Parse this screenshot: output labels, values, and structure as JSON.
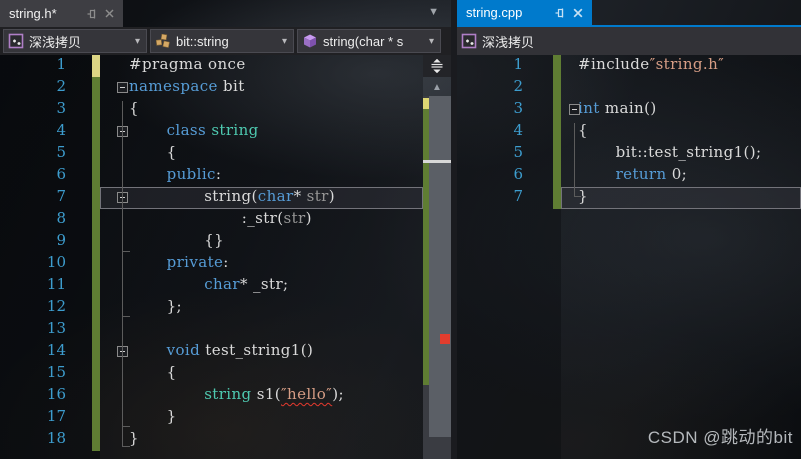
{
  "watermark": "CSDN @跳动的bit",
  "icons": {
    "caret_down": "▾",
    "doc_dropdown": "▼",
    "scroll_up_arrow": "▲"
  },
  "left_pane": {
    "tab": {
      "title": "string.h*"
    },
    "nav": [
      {
        "label": "深浅拷贝",
        "icon": "cpp-project-icon"
      },
      {
        "label": "bit::string",
        "icon": "class-icon"
      },
      {
        "label": "string(char * s",
        "icon": "method-icon"
      }
    ],
    "lines": [
      {
        "n": "1",
        "track": "yellow",
        "ind": 0,
        "segs": [
          [
            "pl",
            "#pragma once"
          ]
        ]
      },
      {
        "n": "2",
        "track": "green",
        "ind": 0,
        "fold": true,
        "segs": [
          [
            "kw",
            "namespace"
          ],
          [
            "pl",
            " bit"
          ]
        ]
      },
      {
        "n": "3",
        "track": "green",
        "ind": 0,
        "segs": [
          [
            "pl",
            "{"
          ]
        ]
      },
      {
        "n": "4",
        "track": "green",
        "ind": 4,
        "fold": true,
        "segs": [
          [
            "kw",
            "class "
          ],
          [
            "ty",
            "string"
          ]
        ]
      },
      {
        "n": "5",
        "track": "green",
        "ind": 4,
        "segs": [
          [
            "pl",
            "{"
          ]
        ]
      },
      {
        "n": "6",
        "track": "green",
        "ind": 4,
        "segs": [
          [
            "kw",
            "public"
          ],
          [
            "pl",
            ":"
          ]
        ]
      },
      {
        "n": "7",
        "track": "green",
        "ind": 8,
        "fold": true,
        "current": true,
        "segs": [
          [
            "pl",
            "string("
          ],
          [
            "kw",
            "char"
          ],
          [
            "pl",
            "* "
          ],
          [
            "param",
            "str"
          ],
          [
            "pl",
            ")"
          ]
        ]
      },
      {
        "n": "8",
        "track": "green",
        "ind": 12,
        "segs": [
          [
            "pl",
            ":_str("
          ],
          [
            "param",
            "str"
          ],
          [
            "pl",
            ")"
          ]
        ]
      },
      {
        "n": "9",
        "track": "green",
        "ind": 8,
        "segs": [
          [
            "pl",
            "{}"
          ]
        ]
      },
      {
        "n": "10",
        "track": "green",
        "ind": 4,
        "segs": [
          [
            "kw",
            "private"
          ],
          [
            "pl",
            ":"
          ]
        ]
      },
      {
        "n": "11",
        "track": "green",
        "ind": 8,
        "segs": [
          [
            "kw",
            "char"
          ],
          [
            "pl",
            "* _str;"
          ]
        ]
      },
      {
        "n": "12",
        "track": "green",
        "ind": 4,
        "segs": [
          [
            "pl",
            "};"
          ]
        ]
      },
      {
        "n": "13",
        "track": "green",
        "ind": 0,
        "segs": []
      },
      {
        "n": "14",
        "track": "green",
        "ind": 4,
        "fold": true,
        "segs": [
          [
            "kw",
            "void"
          ],
          [
            "pl",
            " test_string1()"
          ]
        ]
      },
      {
        "n": "15",
        "track": "green",
        "ind": 4,
        "segs": [
          [
            "pl",
            "{"
          ]
        ]
      },
      {
        "n": "16",
        "track": "green",
        "ind": 8,
        "segs": [
          [
            "ty",
            "string"
          ],
          [
            "pl",
            " s1("
          ],
          [
            "strerr",
            "″hello″"
          ],
          [
            "pl",
            ");"
          ]
        ]
      },
      {
        "n": "17",
        "track": "green",
        "ind": 4,
        "segs": [
          [
            "pl",
            "}"
          ]
        ]
      },
      {
        "n": "18",
        "track": "green",
        "ind": 0,
        "segs": [
          [
            "pl",
            "}"
          ]
        ]
      }
    ]
  },
  "right_pane": {
    "tab": {
      "title": "string.cpp"
    },
    "nav": [
      {
        "label": "深浅拷贝",
        "icon": "cpp-project-icon"
      }
    ],
    "lines": [
      {
        "n": "1",
        "track": "green",
        "ind": 0,
        "segs": [
          [
            "pl",
            "#include"
          ],
          [
            "str",
            "″string.h″"
          ]
        ]
      },
      {
        "n": "2",
        "track": "green",
        "ind": 0,
        "segs": []
      },
      {
        "n": "3",
        "track": "green",
        "ind": 0,
        "fold": true,
        "segs": [
          [
            "kw",
            "int"
          ],
          [
            "pl",
            " main()"
          ]
        ]
      },
      {
        "n": "4",
        "track": "green",
        "ind": 0,
        "segs": [
          [
            "pl",
            "{"
          ]
        ]
      },
      {
        "n": "5",
        "track": "green",
        "ind": 4,
        "segs": [
          [
            "pl",
            "bit::test_string1();"
          ]
        ]
      },
      {
        "n": "6",
        "track": "green",
        "ind": 4,
        "segs": [
          [
            "kw",
            "return"
          ],
          [
            "pl",
            " 0;"
          ]
        ]
      },
      {
        "n": "7",
        "track": "green",
        "ind": 0,
        "current": true,
        "segs": [
          [
            "pl",
            "}"
          ]
        ]
      }
    ]
  },
  "colors": {
    "active_tab": "#007acc",
    "inactive_tab": "#3e3e43",
    "keyword": "#569cd6",
    "type": "#4ec9b0",
    "string_literal": "#d69d85",
    "parameter": "#969696",
    "plain": "#dadada",
    "line_number": "#3d9dce",
    "track_saved": "#5f7d33",
    "track_unsaved": "#dcd584",
    "error_mark": "#e23d2e"
  }
}
